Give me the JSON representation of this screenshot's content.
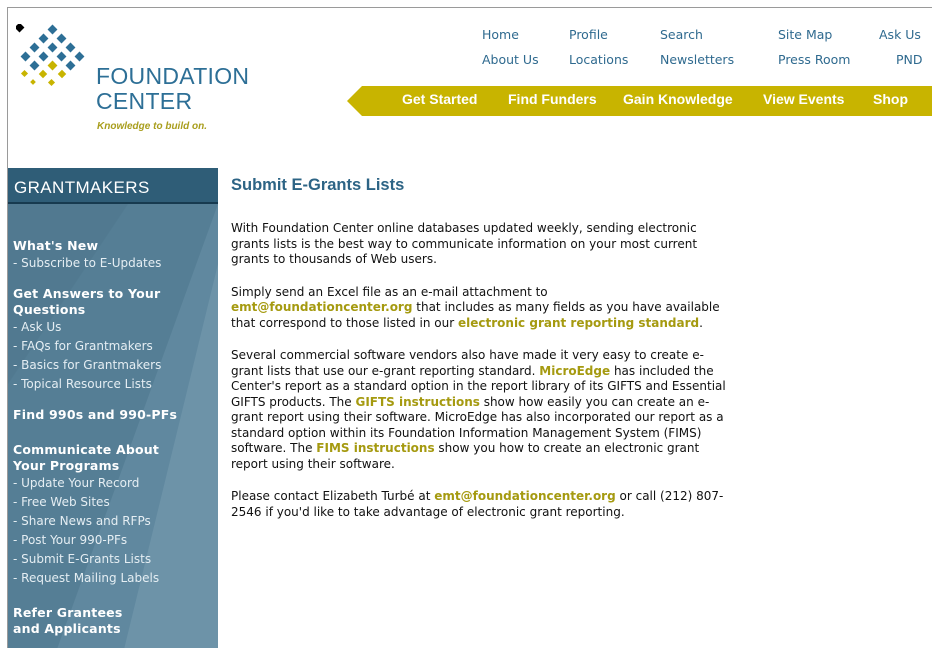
{
  "brand": {
    "name_line1": "FOUNDATION",
    "name_line2": "CENTER",
    "tagline": "Knowledge to build on."
  },
  "top_nav": {
    "home": "Home",
    "profile": "Profile",
    "search": "Search",
    "site_map": "Site Map",
    "ask_us": "Ask Us",
    "about_us": "About Us",
    "locations": "Locations",
    "newsletters": "Newsletters",
    "press_room": "Press Room",
    "pnd": "PND"
  },
  "main_nav": {
    "get_started": "Get Started",
    "find_funders": "Find Funders",
    "gain_knowledge": "Gain Knowledge",
    "view_events": "View Events",
    "shop": "Shop"
  },
  "sidebar": {
    "title": "GRANTMAKERS",
    "groups": [
      {
        "heading": "What's New",
        "links": [
          "- Subscribe to E-Updates"
        ]
      },
      {
        "heading": "Get Answers to Your Questions",
        "links": [
          "- Ask Us",
          "- FAQs for Grantmakers",
          "- Basics for Grantmakers",
          "- Topical Resource Lists"
        ]
      },
      {
        "heading": "Find 990s and 990-PFs",
        "links": []
      },
      {
        "heading": "Communicate About Your Programs",
        "links": [
          "- Update Your Record",
          "- Free Web Sites",
          "- Share News and RFPs",
          "- Post Your 990-PFs",
          "- Submit E-Grants Lists",
          "- Request Mailing Labels"
        ]
      },
      {
        "heading": "Refer Grantees and Applicants",
        "links": []
      }
    ]
  },
  "main": {
    "title": "Submit E-Grants Lists",
    "p1": "With Foundation Center online databases updated weekly, sending electronic grants lists is the best way to communicate information on your most current grants to thousands of Web users.",
    "p2_text1": "Simply send an Excel file as an e-mail attachment to ",
    "p2_link1": "emt@foundationcenter.org",
    "p2_text2": " that includes as many fields as you have available that correspond to those listed in our ",
    "p2_link2": "electronic grant reporting standard",
    "p2_text3": ".",
    "p3_text1": "Several commercial software vendors also have made it very easy to create e-grant lists that use our e-grant reporting standard. ",
    "p3_link1": "MicroEdge",
    "p3_text2": " has included the Center's report as a standard option in the report library of its GIFTS and Essential GIFTS products. The ",
    "p3_link2": "GIFTS instructions",
    "p3_text3": " show how easily you can create an e-grant report using their software. MicroEdge has also incorporated our report as a standard option within its Foundation Information Management System (FIMS) software. The ",
    "p3_link3": "FIMS instructions",
    "p3_text4": " show you how to create an electronic grant report using their software.",
    "p4_text1": "Please contact Elizabeth Turbé at ",
    "p4_link1": "emt@foundationcenter.org",
    "p4_text2": " or call (212) 807-2546 if you'd like to take advantage of electronic grant reporting."
  },
  "colors": {
    "brand_blue": "#2d6f96",
    "nav_gold": "#c8b400",
    "link_gold": "#a59a10",
    "sidebar_blue": "#557e95",
    "sidebar_header": "#2f5d77"
  }
}
